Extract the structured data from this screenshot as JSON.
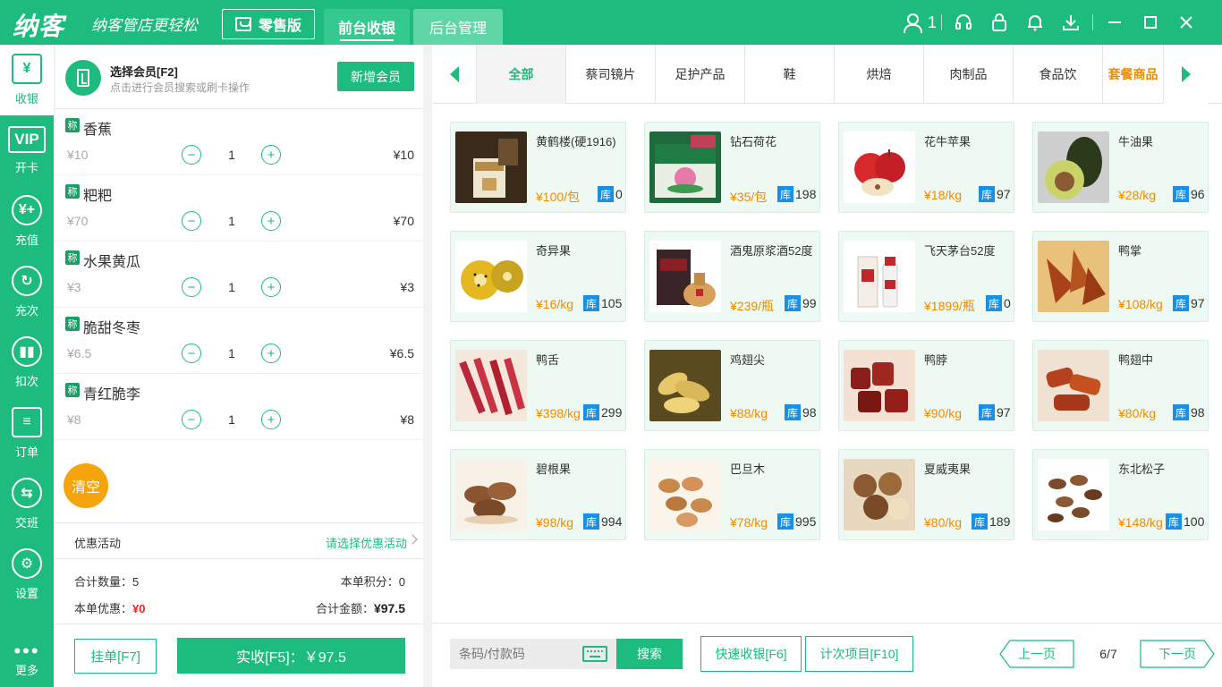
{
  "header": {
    "logo": "纳客",
    "slogan": "纳客管店更轻松",
    "mode_label": "零售版",
    "tabs": [
      {
        "label": "前台收银",
        "active": true
      },
      {
        "label": "后台管理",
        "active": false
      }
    ],
    "user_count": "1",
    "colors": {
      "brand": "#1dbb7d",
      "accent": "#f08c00"
    }
  },
  "nav": {
    "items": [
      {
        "label": "收银",
        "icon": "cashier-icon",
        "glyph": "¥",
        "active": true
      },
      {
        "label": "开卡",
        "icon": "vip-card-icon",
        "glyph": "VIP",
        "active": false
      },
      {
        "label": "充值",
        "icon": "recharge-icon",
        "glyph": "¥+",
        "active": false
      },
      {
        "label": "充次",
        "icon": "recharge-times-icon",
        "glyph": "↻",
        "active": false
      },
      {
        "label": "扣次",
        "icon": "deduct-times-icon",
        "glyph": "▮▮",
        "active": false
      },
      {
        "label": "订单",
        "icon": "order-icon",
        "glyph": "≡",
        "active": false
      },
      {
        "label": "交班",
        "icon": "shift-handover-icon",
        "glyph": "⇆",
        "active": false
      },
      {
        "label": "设置",
        "icon": "settings-gear-icon",
        "glyph": "⚙",
        "active": false
      }
    ],
    "more_label": "更多"
  },
  "cart": {
    "member_title": "选择会员[F2]",
    "member_hint": "点击进行会员搜索或刷卡操作",
    "new_member_label": "新增会员",
    "weigh_badge": "称",
    "items": [
      {
        "name": "香蕉",
        "unit_price": "¥10",
        "qty": "1",
        "subtotal": "¥10"
      },
      {
        "name": "粑粑",
        "unit_price": "¥70",
        "qty": "1",
        "subtotal": "¥70"
      },
      {
        "name": "水果黄瓜",
        "unit_price": "¥3",
        "qty": "1",
        "subtotal": "¥3"
      },
      {
        "name": "脆甜冬枣",
        "unit_price": "¥6.5",
        "qty": "1",
        "subtotal": "¥6.5"
      },
      {
        "name": "青红脆李",
        "unit_price": "¥8",
        "qty": "1",
        "subtotal": "¥8"
      }
    ],
    "clear_label": "清空",
    "promo_label": "优惠活动",
    "promo_select": "请选择优惠活动",
    "total_qty_label": "合计数量：",
    "total_qty": "5",
    "points_label": "本单积分：",
    "points": "0",
    "discount_label": "本单优惠：",
    "discount": "¥0",
    "total_amount_label": "合计金额：",
    "total_amount": "¥97.5",
    "hold_label": "挂单[F7]",
    "pay_label": "实收[F5]：￥97.5"
  },
  "categories": {
    "items": [
      {
        "label": "全部",
        "style": "active"
      },
      {
        "label": "蔡司镜片",
        "style": ""
      },
      {
        "label": "足护产品",
        "style": ""
      },
      {
        "label": "鞋",
        "style": ""
      },
      {
        "label": "烘焙",
        "style": ""
      },
      {
        "label": "肉制品",
        "style": ""
      },
      {
        "label": "食品饮",
        "style": ""
      },
      {
        "label": "套餐商品",
        "style": "orange"
      }
    ]
  },
  "products": {
    "stock_badge": "库",
    "items": [
      {
        "name": "黄鹤楼(硬1916)",
        "price": "¥100/包",
        "stock": "0",
        "thumb": "cigarette-pack"
      },
      {
        "name": "钻石荷花",
        "price": "¥35/包",
        "stock": "198",
        "thumb": "cigarette-lotus"
      },
      {
        "name": "花牛苹果",
        "price": "¥18/kg",
        "stock": "97",
        "thumb": "apple"
      },
      {
        "name": "牛油果",
        "price": "¥28/kg",
        "stock": "96",
        "thumb": "avocado"
      },
      {
        "name": "奇异果",
        "price": "¥16/kg",
        "stock": "105",
        "thumb": "kiwi"
      },
      {
        "name": "酒鬼原浆酒52度",
        "price": "¥239/瓶",
        "stock": "99",
        "thumb": "liquor-box"
      },
      {
        "name": "飞天茅台52度",
        "price": "¥1899/瓶",
        "stock": "0",
        "thumb": "moutai"
      },
      {
        "name": "鸭掌",
        "price": "¥108/kg",
        "stock": "97",
        "thumb": "duck-feet"
      },
      {
        "name": "鸭舌",
        "price": "¥398/kg",
        "stock": "299",
        "thumb": "duck-tongue"
      },
      {
        "name": "鸡翅尖",
        "price": "¥88/kg",
        "stock": "98",
        "thumb": "wing-tips"
      },
      {
        "name": "鸭脖",
        "price": "¥90/kg",
        "stock": "97",
        "thumb": "duck-neck"
      },
      {
        "name": "鸭翅中",
        "price": "¥80/kg",
        "stock": "98",
        "thumb": "duck-wing"
      },
      {
        "name": "碧根果",
        "price": "¥98/kg",
        "stock": "994",
        "thumb": "pecan"
      },
      {
        "name": "巴旦木",
        "price": "¥78/kg",
        "stock": "995",
        "thumb": "almond"
      },
      {
        "name": "夏威夷果",
        "price": "¥80/kg",
        "stock": "189",
        "thumb": "macadamia"
      },
      {
        "name": "东北松子",
        "price": "¥148/kg",
        "stock": "100",
        "thumb": "pine-nut"
      }
    ]
  },
  "bottom": {
    "barcode_placeholder": "条码/付款码",
    "search_label": "搜索",
    "quick_label": "快速收银[F6]",
    "count_label": "计次项目[F10]",
    "prev_label": "上一页",
    "page": "6/7",
    "next_label": "下一页"
  }
}
